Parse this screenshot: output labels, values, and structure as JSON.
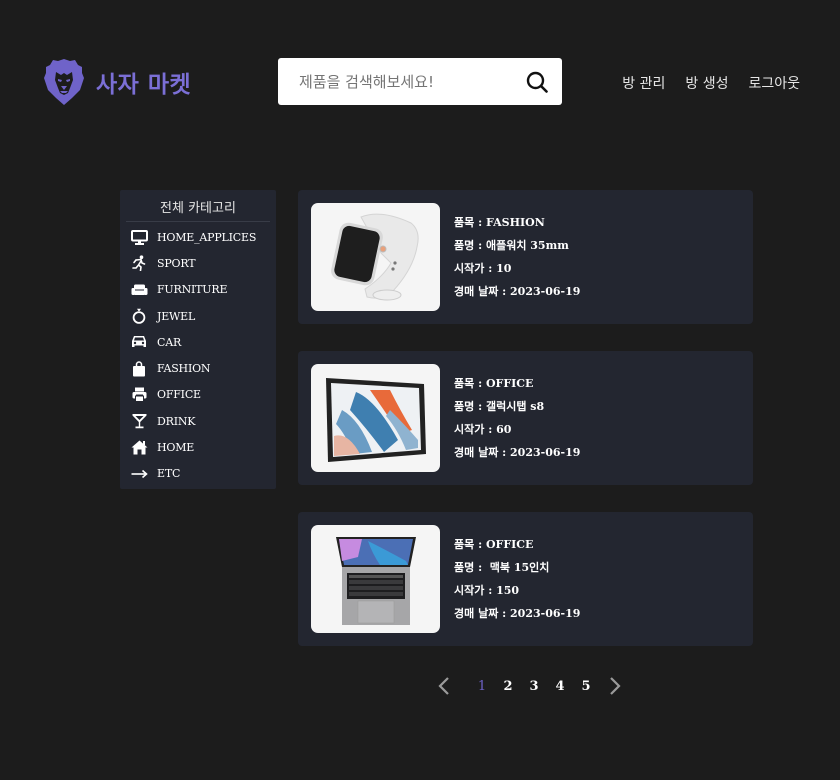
{
  "header": {
    "brand": "사자 마켓",
    "brand_color": "#7b6fd6",
    "search": {
      "placeholder": "제품을 검색해보세요!",
      "value": "",
      "icon": "search-icon"
    },
    "nav": [
      {
        "label": "방 관리"
      },
      {
        "label": "방 생성"
      },
      {
        "label": "로그아웃"
      }
    ]
  },
  "sidebar": {
    "title": "전체 카테고리",
    "items": [
      {
        "label": "HOME_APPLICES",
        "icon": "monitor-icon"
      },
      {
        "label": "SPORT",
        "icon": "running-icon"
      },
      {
        "label": "FURNITURE",
        "icon": "couch-icon"
      },
      {
        "label": "JEWEL",
        "icon": "ring-icon"
      },
      {
        "label": "CAR",
        "icon": "car-icon"
      },
      {
        "label": "FASHION",
        "icon": "shopping-bag-icon"
      },
      {
        "label": "OFFICE",
        "icon": "printer-icon"
      },
      {
        "label": "DRINK",
        "icon": "cocktail-icon"
      },
      {
        "label": "HOME",
        "icon": "house-icon"
      },
      {
        "label": "ETC",
        "icon": "arrow-right-icon"
      }
    ]
  },
  "products": [
    {
      "image": "apple-watch-image",
      "category": "품목 : FASHION",
      "name": "품명 : 애플워치 35mm",
      "start_price": "시작가 : 10",
      "auction_date": "경매 날짜 : 2023-06-19"
    },
    {
      "image": "galaxy-tab-image",
      "category": "품목 : OFFICE",
      "name": "품명 : 갤럭시탭 s8",
      "start_price": "시작가 : 60",
      "auction_date": "경매 날짜 : 2023-06-19"
    },
    {
      "image": "macbook-image",
      "category": "품목 : OFFICE",
      "name": "품명 :  맥북 15인치",
      "start_price": "시작가 : 150",
      "auction_date": "경매 날짜 : 2023-06-19"
    }
  ],
  "pagination": {
    "current": "1",
    "pages": [
      "1",
      "2",
      "3",
      "4",
      "5"
    ],
    "active_color": "#6f63c9"
  }
}
